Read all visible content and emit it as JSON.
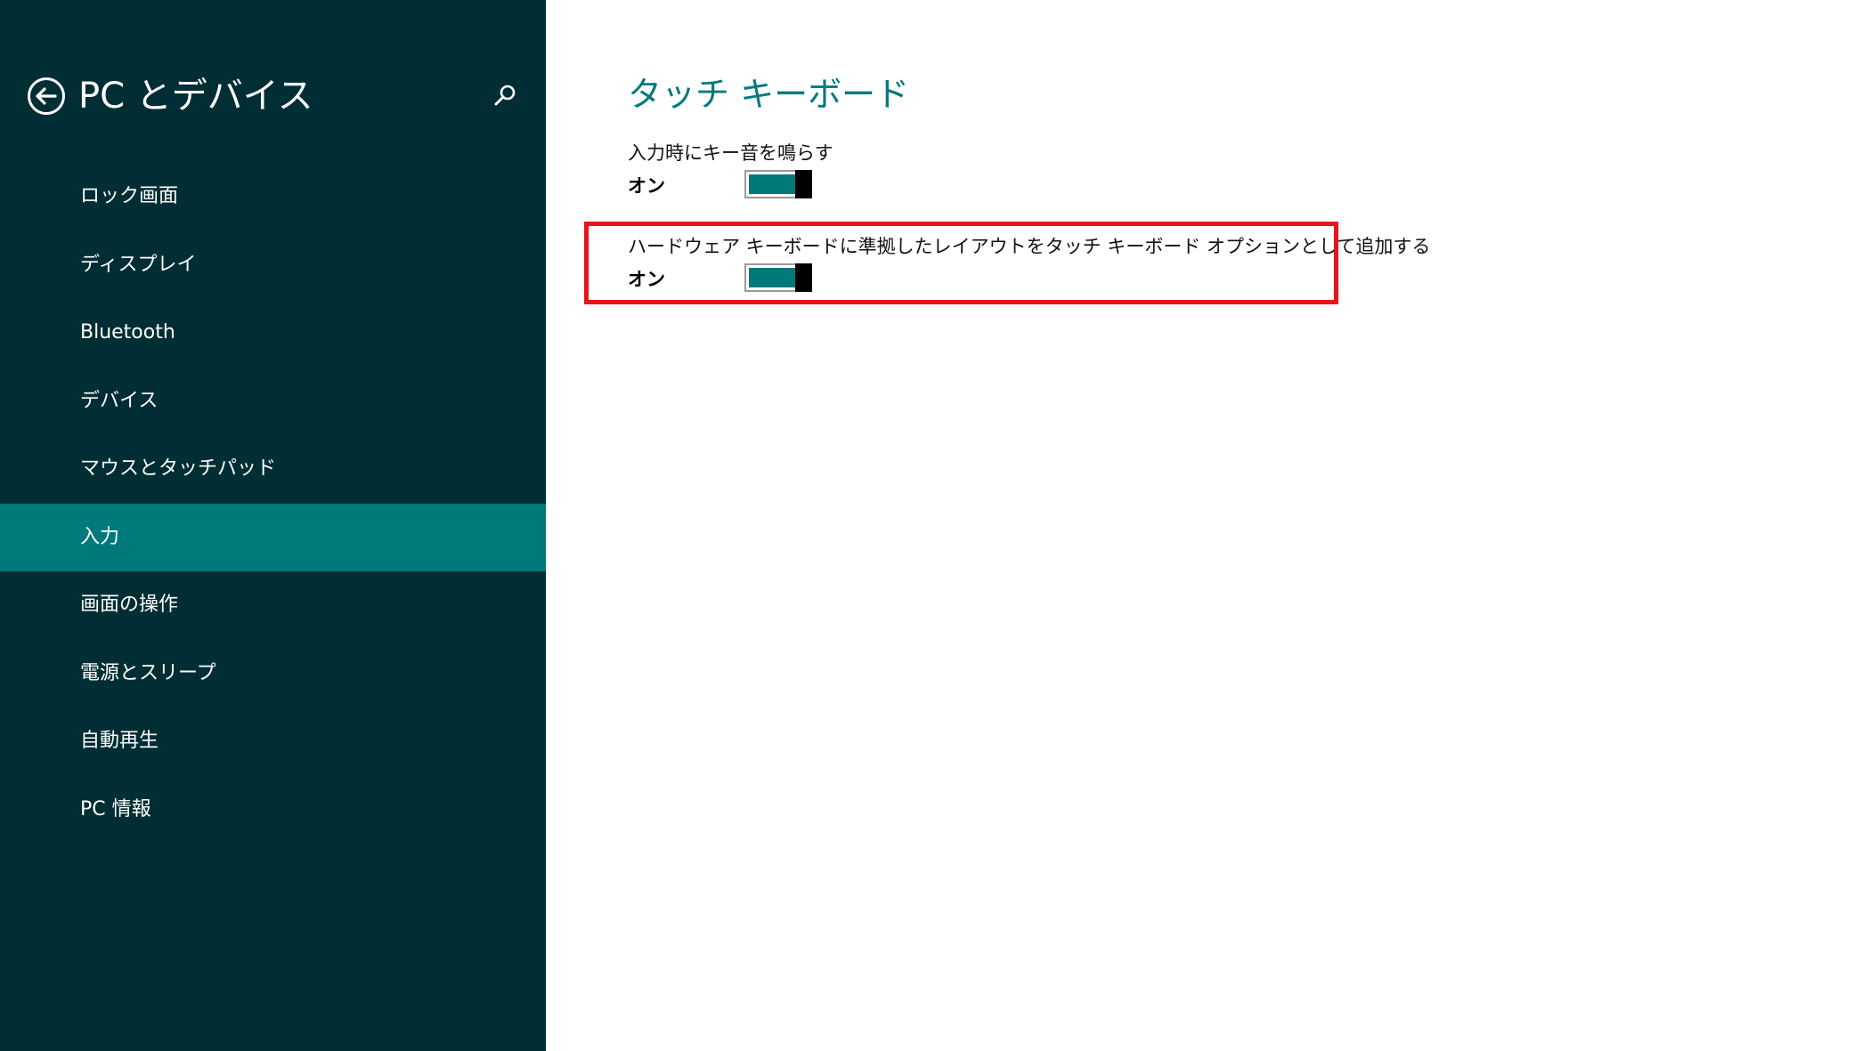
{
  "sidebar": {
    "title": "PC とデバイス",
    "back_icon": "back-arrow-circle-icon",
    "search_icon": "search-icon",
    "items": [
      {
        "label": "ロック画面",
        "active": false
      },
      {
        "label": "ディスプレイ",
        "active": false
      },
      {
        "label": "Bluetooth",
        "active": false
      },
      {
        "label": "デバイス",
        "active": false
      },
      {
        "label": "マウスとタッチパッド",
        "active": false
      },
      {
        "label": "入力",
        "active": true
      },
      {
        "label": "画面の操作",
        "active": false
      },
      {
        "label": "電源とスリープ",
        "active": false
      },
      {
        "label": "自動再生",
        "active": false
      },
      {
        "label": "PC 情報",
        "active": false
      }
    ]
  },
  "main": {
    "section_title": "タッチ キーボード",
    "settings": [
      {
        "label": "入力時にキー音を鳴らす",
        "state": "オン",
        "on": true
      },
      {
        "label": "ハードウェア キーボードに準拠したレイアウトをタッチ キーボード オプションとして追加する",
        "state": "オン",
        "on": true
      }
    ]
  },
  "colors": {
    "sidebar_bg": "#002e34",
    "accent": "#00797a",
    "highlight": "#e8141b"
  }
}
